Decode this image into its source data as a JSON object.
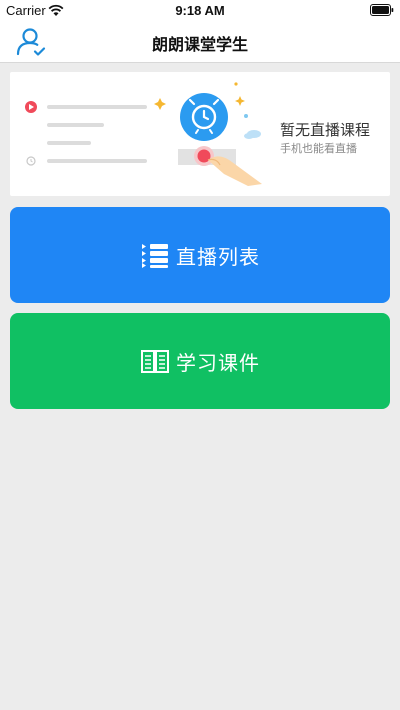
{
  "status_bar": {
    "carrier": "Carrier",
    "time": "9:18 AM"
  },
  "nav": {
    "title": "朗朗课堂学生",
    "user_icon": "user-check-icon"
  },
  "banner": {
    "title": "暂无直播课程",
    "subtitle": "手机也能看直播",
    "illustration": "alarm-clock-illustration"
  },
  "buttons": {
    "live_list": {
      "label": "直播列表",
      "icon": "list-icon",
      "color": "#1f86f5"
    },
    "courseware": {
      "label": "学习课件",
      "icon": "book-icon",
      "color": "#10c063"
    }
  },
  "colors": {
    "accent_blue": "#1f86f5",
    "accent_green": "#10c063",
    "background": "#ececec"
  }
}
